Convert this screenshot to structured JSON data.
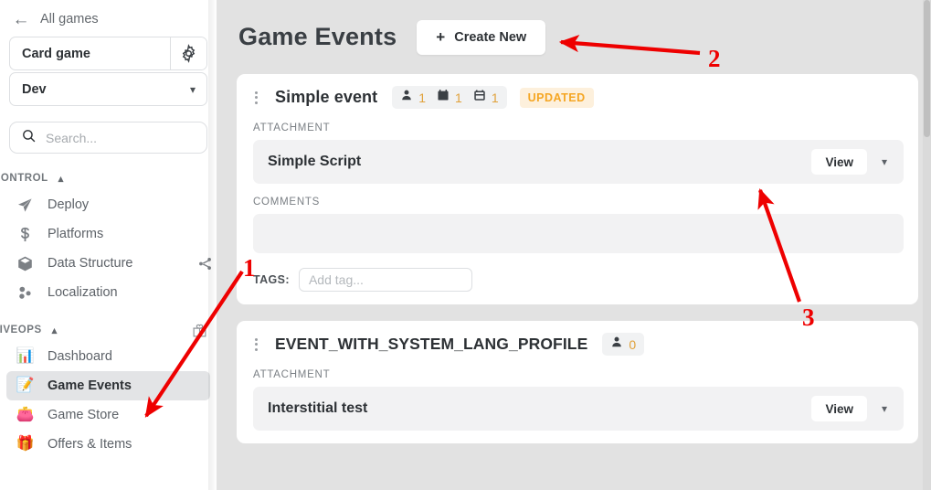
{
  "sidebar": {
    "back": {
      "label": "All games",
      "icon": "back-arrow-icon"
    },
    "game": {
      "name": "Card game",
      "settings_icon": "gear-icon"
    },
    "environment": {
      "name": "Dev",
      "chevron": "chevron-down-icon"
    },
    "search": {
      "placeholder": "Search...",
      "value": "",
      "icon": "search-icon"
    },
    "sections": [
      {
        "title": "CONTROL",
        "collapsed": false,
        "caret": "chevron-up-icon",
        "items": [
          {
            "label": "Deploy",
            "icon": "paper-plane-icon",
            "active": false,
            "extra_icon": ""
          },
          {
            "label": "Platforms",
            "icon": "dollar-icon",
            "active": false,
            "extra_icon": ""
          },
          {
            "label": "Data Structure",
            "icon": "cube-icon",
            "active": false,
            "extra_icon": "share-icon"
          },
          {
            "label": "Localization",
            "icon": "localization-icon",
            "active": false,
            "extra_icon": ""
          }
        ]
      },
      {
        "title": "LIVEOPS",
        "collapsed": false,
        "caret": "chevron-up-icon",
        "header_extra_icon": "gift-outline-icon",
        "items": [
          {
            "label": "Dashboard",
            "icon": "bar-chart-emoji",
            "glyph": "📊",
            "active": false,
            "extra_icon": ""
          },
          {
            "label": "Game Events",
            "icon": "notepad-emoji",
            "glyph": "📝",
            "active": true,
            "extra_icon": ""
          },
          {
            "label": "Game Store",
            "icon": "shopping-bags-emoji",
            "glyph": "👛",
            "active": false,
            "extra_icon": ""
          },
          {
            "label": "Offers & Items",
            "icon": "gift-emoji",
            "glyph": "🎁",
            "active": false,
            "extra_icon": ""
          }
        ]
      }
    ]
  },
  "header": {
    "title": "Game Events",
    "create_button": {
      "label": "Create New",
      "plus": "+"
    }
  },
  "events": [
    {
      "menu_icon": "kebab-menu-icon",
      "title": "Simple event",
      "badges": [
        {
          "icon": "person-icon",
          "count": "1"
        },
        {
          "icon": "calendar-solid-icon",
          "count": "1"
        },
        {
          "icon": "calendar-open-icon",
          "count": "1"
        }
      ],
      "status": "UPDATED",
      "attachment_label": "ATTACHMENT",
      "attachment": {
        "name": "Simple Script",
        "view_label": "View",
        "chevron": "chevron-down-icon"
      },
      "comments_label": "COMMENTS",
      "comments_value": "",
      "tags_label": "TAGS:",
      "tag_placeholder": "Add tag...",
      "tag_value": ""
    },
    {
      "menu_icon": "kebab-menu-icon",
      "title": "EVENT_WITH_SYSTEM_LANG_PROFILE",
      "badges": [
        {
          "icon": "person-icon",
          "count": "0"
        }
      ],
      "status": "",
      "attachment_label": "ATTACHMENT",
      "attachment": {
        "name": "Interstitial test",
        "view_label": "View",
        "chevron": "chevron-down-icon"
      }
    }
  ],
  "annotations": [
    {
      "label": "1",
      "target": "sidebar-item-game-events"
    },
    {
      "label": "2",
      "target": "create-new-button"
    },
    {
      "label": "3",
      "target": "attachment-row-simple-script"
    }
  ],
  "colors": {
    "accent_orange": "#f5a623",
    "status_bg": "#fdf0dc",
    "annotation_red": "#ee0000",
    "main_bg": "#e2e2e2",
    "active_nav": "#e3e4e6"
  }
}
